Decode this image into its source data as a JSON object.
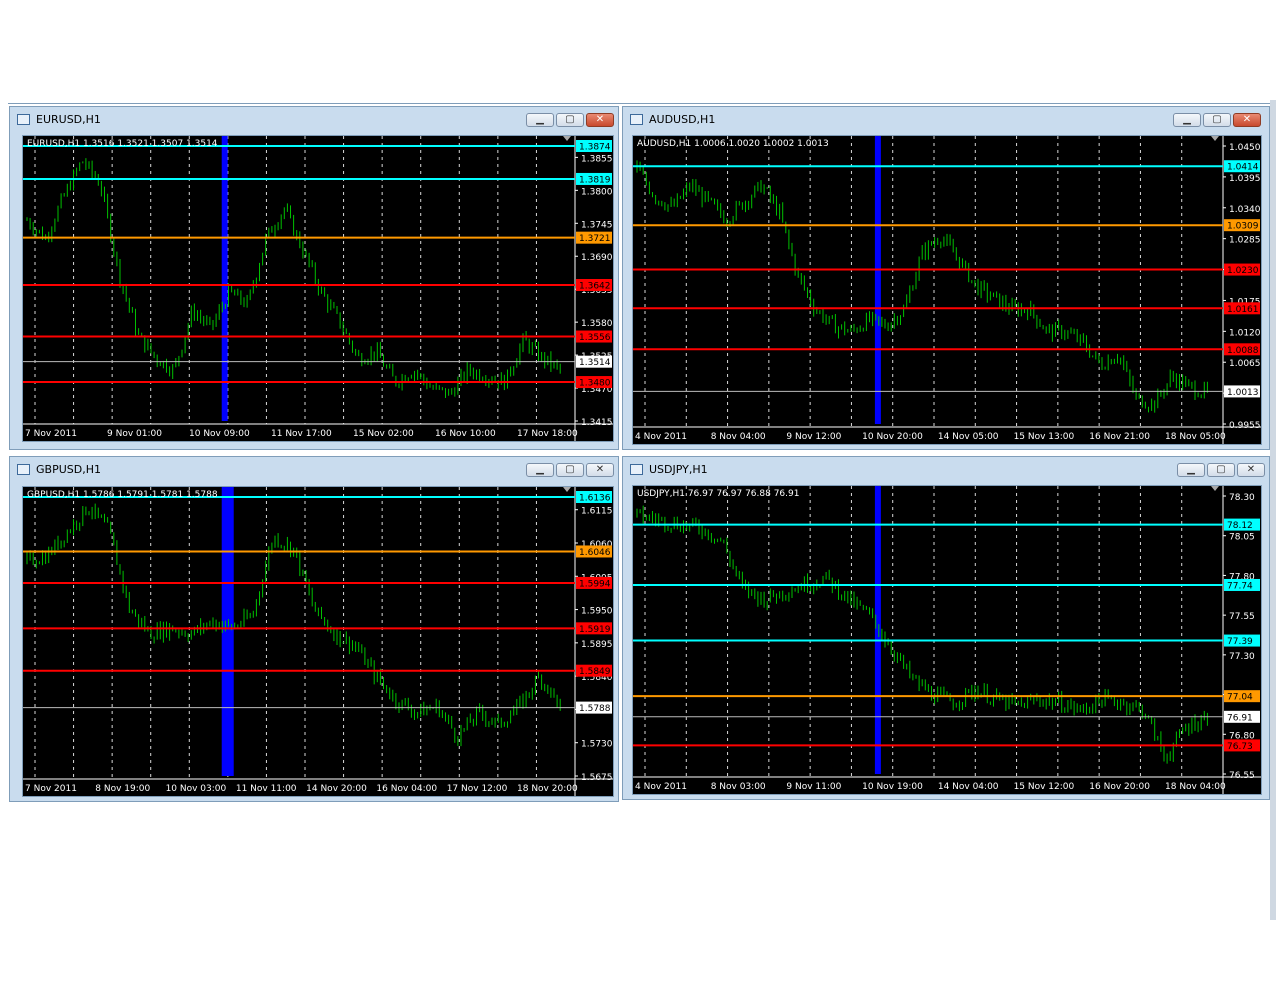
{
  "colors": {
    "background": "#000000",
    "candle": "#00c000",
    "grid": "#ffffff",
    "axis_text": "#ffffff",
    "cyan": "#00ffff",
    "orange": "#ff9900",
    "red": "#ff0000",
    "blue_band": "#0000ff"
  },
  "window_buttons": {
    "minimize": "▁",
    "maximize": "▢",
    "close": "✕"
  },
  "charts": [
    {
      "id": "eurusd",
      "title": "EURUSD,H1",
      "info": "EURUSD,H1  1.3516 1.3521 1.3507 1.3514",
      "ylim": [
        1.3415,
        1.3874
      ],
      "y_ticks": [
        "1.3855",
        "1.3800",
        "1.3745",
        "1.3690",
        "1.3635",
        "1.3580",
        "1.3525",
        "1.3470",
        "1.3415"
      ],
      "x_labels": [
        "7 Nov 2011",
        "9 Nov 01:00",
        "10 Nov 09:00",
        "11 Nov 17:00",
        "15 Nov 02:00",
        "16 Nov 10:00",
        "17 Nov 18:00"
      ],
      "levels": [
        {
          "value": 1.3874,
          "label": "1.3874",
          "color": "cyan"
        },
        {
          "value": 1.3819,
          "label": "1.3819",
          "color": "cyan"
        },
        {
          "value": 1.3721,
          "label": "1.3721",
          "color": "orange"
        },
        {
          "value": 1.3642,
          "label": "1.3642",
          "color": "red"
        },
        {
          "value": 1.3556,
          "label": "1.3556",
          "color": "red"
        },
        {
          "value": 1.348,
          "label": "1.3480",
          "color": "red"
        }
      ],
      "current": {
        "value": 1.3514,
        "label": "1.3514"
      },
      "price_points": [
        1.375,
        1.372,
        1.379,
        1.385,
        1.381,
        1.366,
        1.356,
        1.352,
        1.35,
        1.36,
        1.357,
        1.363,
        1.361,
        1.372,
        1.377,
        1.37,
        1.363,
        1.358,
        1.352,
        1.353,
        1.348,
        1.35,
        1.347,
        1.346,
        1.35,
        1.349,
        1.348,
        1.355,
        1.352,
        1.35
      ],
      "last_label": "1.3514"
    },
    {
      "id": "audusd",
      "title": "AUDUSD,H1",
      "info": "AUDUSD,H1  1.0006 1.0020 1.0002 1.0013",
      "ylim": [
        0.9955,
        1.045
      ],
      "y_ticks": [
        "1.0450",
        "1.0395",
        "1.0340",
        "1.0285",
        "1.0230",
        "1.0175",
        "1.0120",
        "1.0065",
        "1.0010",
        "0.9955"
      ],
      "x_labels": [
        "4 Nov 2011",
        "8 Nov 04:00",
        "9 Nov 12:00",
        "10 Nov 20:00",
        "14 Nov 05:00",
        "15 Nov 13:00",
        "16 Nov 21:00",
        "18 Nov 05:00"
      ],
      "levels": [
        {
          "value": 1.0414,
          "label": "1.0414",
          "color": "cyan"
        },
        {
          "value": 1.0309,
          "label": "1.0309",
          "color": "orange"
        },
        {
          "value": 1.023,
          "label": "1.0230",
          "color": "red"
        },
        {
          "value": 1.0161,
          "label": "1.0161",
          "color": "red"
        },
        {
          "value": 1.0088,
          "label": "1.0088",
          "color": "red"
        }
      ],
      "current": {
        "value": 1.0013,
        "label": "1.0013"
      },
      "price_points": [
        1.041,
        1.036,
        1.034,
        1.038,
        1.035,
        1.032,
        1.035,
        1.038,
        1.033,
        1.022,
        1.016,
        1.013,
        1.012,
        1.014,
        1.013,
        1.016,
        1.026,
        1.029,
        1.025,
        1.02,
        1.018,
        1.016,
        1.016,
        1.012,
        1.012,
        1.01,
        1.006,
        1.008,
        1.0,
        0.999,
        1.004,
        1.002,
        1.001
      ],
      "last_label": "1.0013"
    },
    {
      "id": "gbpusd",
      "title": "GBPUSD,H1",
      "info": "GBPUSD,H1  1.5786 1.5791 1.5781 1.5788",
      "ylim": [
        1.5675,
        1.6136
      ],
      "y_ticks": [
        "1.6115",
        "1.6060",
        "1.6005",
        "1.5950",
        "1.5895",
        "1.5840",
        "1.5785",
        "1.5730",
        "1.5675"
      ],
      "x_labels": [
        "7 Nov 2011",
        "8 Nov 19:00",
        "10 Nov 03:00",
        "11 Nov 11:00",
        "14 Nov 20:00",
        "16 Nov 04:00",
        "17 Nov 12:00",
        "18 Nov 20:00"
      ],
      "levels": [
        {
          "value": 1.6136,
          "label": "1.6136",
          "color": "cyan"
        },
        {
          "value": 1.6046,
          "label": "1.6046",
          "color": "orange"
        },
        {
          "value": 1.5994,
          "label": "1.5994",
          "color": "red"
        },
        {
          "value": 1.5919,
          "label": "1.5919",
          "color": "red"
        },
        {
          "value": 1.5849,
          "label": "1.5849",
          "color": "red"
        }
      ],
      "current": {
        "value": 1.5788,
        "label": "1.5788"
      },
      "price_points": [
        1.603,
        1.604,
        1.608,
        1.612,
        1.608,
        1.595,
        1.591,
        1.592,
        1.591,
        1.593,
        1.592,
        1.594,
        1.607,
        1.605,
        1.595,
        1.591,
        1.589,
        1.584,
        1.58,
        1.578,
        1.579,
        1.574,
        1.578,
        1.576,
        1.579,
        1.584,
        1.579
      ],
      "last_label": "1.5788"
    },
    {
      "id": "usdjpy",
      "title": "USDJPY,H1",
      "info": "USDJPY,H1  76.97 76.97 76.88 76.91",
      "ylim": [
        76.55,
        78.3
      ],
      "y_ticks": [
        "78.30",
        "78.05",
        "77.80",
        "77.55",
        "77.30",
        "77.05",
        "76.80",
        "76.55"
      ],
      "x_labels": [
        "4 Nov 2011",
        "8 Nov 03:00",
        "9 Nov 11:00",
        "10 Nov 19:00",
        "14 Nov 04:00",
        "15 Nov 12:00",
        "16 Nov 20:00",
        "18 Nov 04:00"
      ],
      "levels": [
        {
          "value": 78.12,
          "label": "78.12",
          "color": "cyan"
        },
        {
          "value": 77.74,
          "label": "77.74",
          "color": "cyan"
        },
        {
          "value": 77.39,
          "label": "77.39",
          "color": "cyan"
        },
        {
          "value": 77.04,
          "label": "77.04",
          "color": "orange"
        },
        {
          "value": 76.73,
          "label": "76.73",
          "color": "red"
        }
      ],
      "current": {
        "value": 76.91,
        "label": "76.91"
      },
      "price_points": [
        78.18,
        78.15,
        78.12,
        78.1,
        78.02,
        77.72,
        77.65,
        77.7,
        77.75,
        77.78,
        77.65,
        77.55,
        77.35,
        77.15,
        77.05,
        77.0,
        77.08,
        77.02,
        76.98,
        77.02,
        77.0,
        76.95,
        77.02,
        77.0,
        76.95,
        76.65,
        76.85,
        76.91
      ],
      "last_label": "76.91"
    }
  ]
}
